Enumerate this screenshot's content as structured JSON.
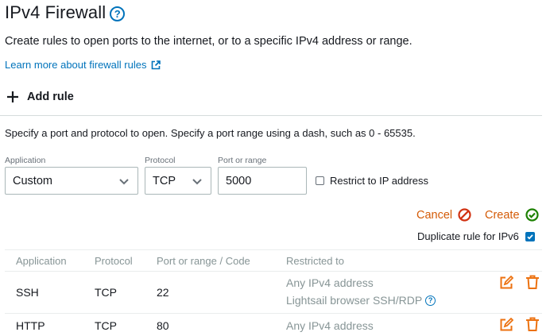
{
  "header": {
    "title": "IPv4 Firewall",
    "help_glyph": "?",
    "description": "Create rules to open ports to the internet, or to a specific IPv4 address or range.",
    "learn_more": "Learn more about firewall rules"
  },
  "add_rule": {
    "label": "Add rule",
    "instructions": "Specify a port and protocol to open. Specify a port range using a dash, such as 0 - 65535."
  },
  "form": {
    "application_label": "Application",
    "application_value": "Custom",
    "protocol_label": "Protocol",
    "protocol_value": "TCP",
    "port_label": "Port or range",
    "port_value": "5000",
    "restrict_label": "Restrict to IP address",
    "cancel_label": "Cancel",
    "create_label": "Create",
    "duplicate_label": "Duplicate rule for IPv6"
  },
  "table": {
    "columns": [
      "Application",
      "Protocol",
      "Port or range / Code",
      "Restricted to"
    ],
    "rows": [
      {
        "application": "SSH",
        "protocol": "TCP",
        "port": "22",
        "restricted": "Any IPv4 address",
        "extra": "Lightsail browser SSH/RDP"
      },
      {
        "application": "HTTP",
        "protocol": "TCP",
        "port": "80",
        "restricted": "Any IPv4 address"
      }
    ]
  },
  "colors": {
    "link": "#0073bb",
    "action_orange": "#d45b07",
    "create_green": "#1d8102",
    "cancel_red": "#d13212",
    "muted": "#879596"
  },
  "icons": [
    "help-icon",
    "external-link-icon",
    "plus-icon",
    "chevron-down-icon",
    "cancel-icon",
    "check-circle-icon",
    "edit-icon",
    "delete-icon"
  ]
}
